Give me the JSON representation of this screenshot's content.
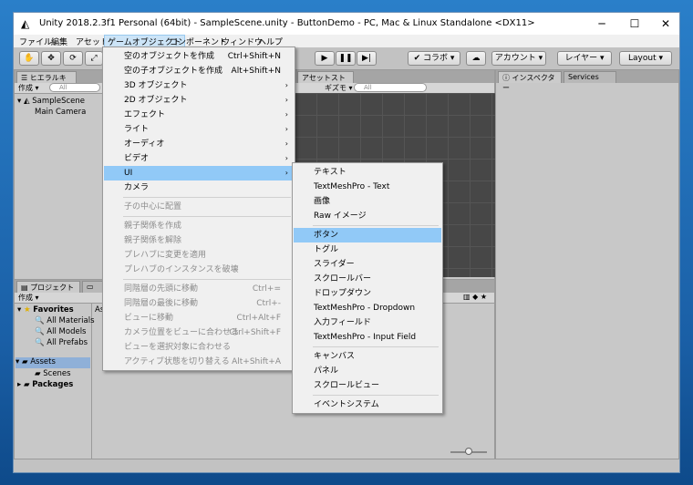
{
  "window": {
    "title": "Unity 2018.2.3f1 Personal (64bit) - SampleScene.unity - ButtonDemo - PC, Mac & Linux Standalone <DX11>"
  },
  "menubar": [
    "ファイル",
    "編集",
    "アセット",
    "ゲームオブジェクト",
    "コンポーネント",
    "ウィンドウ",
    "ヘルプ"
  ],
  "toolbar": {
    "collab": "コラボ",
    "account": "アカウント",
    "layers": "レイヤー",
    "layout": "Layout"
  },
  "hierarchy": {
    "tab": "ヒエラルキー",
    "create": "作成",
    "search": "All",
    "scene": "SampleScene",
    "items": [
      "Main Camera"
    ]
  },
  "scene": {
    "tab_store": "アセットストア",
    "gizmos": "ギズモ",
    "search": "All"
  },
  "inspector": {
    "tab": "インスペクター",
    "services": "Services"
  },
  "project": {
    "tab": "プロジェクト",
    "create": "作成",
    "favorites": "Favorites",
    "fav_items": [
      "All Materials",
      "All Models",
      "All Prefabs"
    ],
    "assets": "Assets",
    "assets_children": [
      "Scenes"
    ],
    "packages": "Packages",
    "assets_col_header": "As"
  },
  "gameobject_menu": [
    {
      "label": "空のオブジェクトを作成",
      "shortcut": "Ctrl+Shift+N"
    },
    {
      "label": "空の子オブジェクトを作成",
      "shortcut": "Alt+Shift+N"
    },
    {
      "label": "3D オブジェクト",
      "submenu": true
    },
    {
      "label": "2D オブジェクト",
      "submenu": true
    },
    {
      "label": "エフェクト",
      "submenu": true
    },
    {
      "label": "ライト",
      "submenu": true
    },
    {
      "label": "オーディオ",
      "submenu": true
    },
    {
      "label": "ビデオ",
      "submenu": true
    },
    {
      "label": "UI",
      "submenu": true,
      "highlighted": true
    },
    {
      "label": "カメラ"
    },
    {
      "label": "子の中心に配置",
      "disabled": true
    },
    {
      "label": "親子関係を作成",
      "disabled": true
    },
    {
      "label": "親子関係を解除",
      "disabled": true
    },
    {
      "label": "プレハブに変更を適用",
      "disabled": true
    },
    {
      "label": "プレハブのインスタンスを破壊",
      "disabled": true
    },
    {
      "label": "同階層の先頭に移動",
      "shortcut": "Ctrl+=",
      "disabled": true
    },
    {
      "label": "同階層の最後に移動",
      "shortcut": "Ctrl+-",
      "disabled": true
    },
    {
      "label": "ビューに移動",
      "shortcut": "Ctrl+Alt+F",
      "disabled": true
    },
    {
      "label": "カメラ位置をビューに合わせる",
      "shortcut": "Ctrl+Shift+F",
      "disabled": true
    },
    {
      "label": "ビューを選択対象に合わせる",
      "disabled": true
    },
    {
      "label": "アクティブ状態を切り替える",
      "shortcut": "Alt+Shift+A",
      "disabled": true
    }
  ],
  "ui_submenu": [
    {
      "label": "テキスト"
    },
    {
      "label": "TextMeshPro - Text"
    },
    {
      "label": "画像"
    },
    {
      "label": "Raw イメージ"
    },
    {
      "label": "ボタン",
      "highlighted": true
    },
    {
      "label": "トグル"
    },
    {
      "label": "スライダー"
    },
    {
      "label": "スクロールバー"
    },
    {
      "label": "ドロップダウン"
    },
    {
      "label": "TextMeshPro - Dropdown"
    },
    {
      "label": "入力フィールド"
    },
    {
      "label": "TextMeshPro - Input Field"
    },
    {
      "label": "キャンバス"
    },
    {
      "label": "パネル"
    },
    {
      "label": "スクロールビュー"
    },
    {
      "label": "イベントシステム"
    }
  ]
}
